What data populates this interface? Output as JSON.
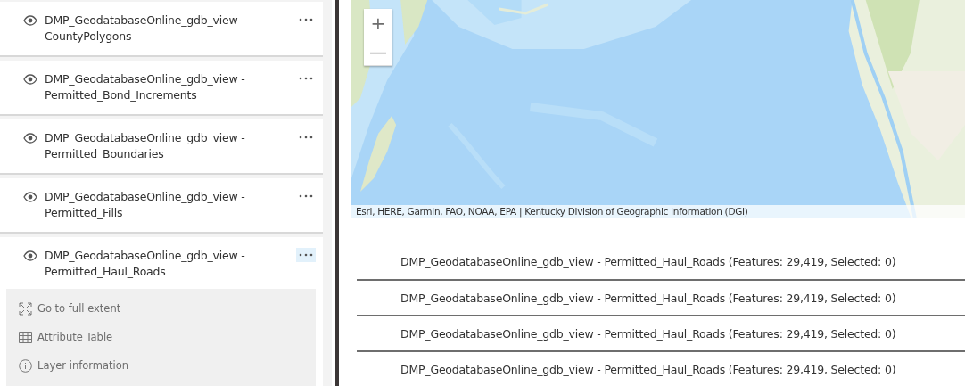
{
  "layers": [
    {
      "title": "DMP_GeodatabaseOnline_gdb_view -",
      "subtitle": "CountyPolygons",
      "expanded": false
    },
    {
      "title": "DMP_GeodatabaseOnline_gdb_view -",
      "subtitle": "Permitted_Bond_Increments",
      "expanded": false
    },
    {
      "title": "DMP_GeodatabaseOnline_gdb_view -",
      "subtitle": "Permitted_Boundaries",
      "expanded": false
    },
    {
      "title": "DMP_GeodatabaseOnline_gdb_view -",
      "subtitle": "Permitted_Fills",
      "expanded": false
    },
    {
      "title": "DMP_GeodatabaseOnline_gdb_view -",
      "subtitle": "Permitted_Haul_Roads",
      "expanded": true
    }
  ],
  "layer_actions": [
    {
      "kind": "extent",
      "label": "Go to full extent"
    },
    {
      "kind": "table",
      "label": "Attribute Table"
    },
    {
      "kind": "info",
      "label": "Layer information"
    }
  ],
  "map": {
    "zoom_in": "+",
    "zoom_out": "—",
    "attribution": "Esri, HERE, Garmin, FAO, NOAA, EPA | Kentucky Division of Geographic Information (DGI)"
  },
  "tables": [
    "DMP_GeodatabaseOnline_gdb_view - Permitted_Haul_Roads (Features: 29,419, Selected: 0)",
    "DMP_GeodatabaseOnline_gdb_view - Permitted_Haul_Roads (Features: 29,419, Selected: 0)",
    "DMP_GeodatabaseOnline_gdb_view - Permitted_Haul_Roads (Features: 29,419, Selected: 0)",
    "DMP_GeodatabaseOnline_gdb_view - Permitted_Haul_Roads (Features: 29,419, Selected: 0)"
  ]
}
